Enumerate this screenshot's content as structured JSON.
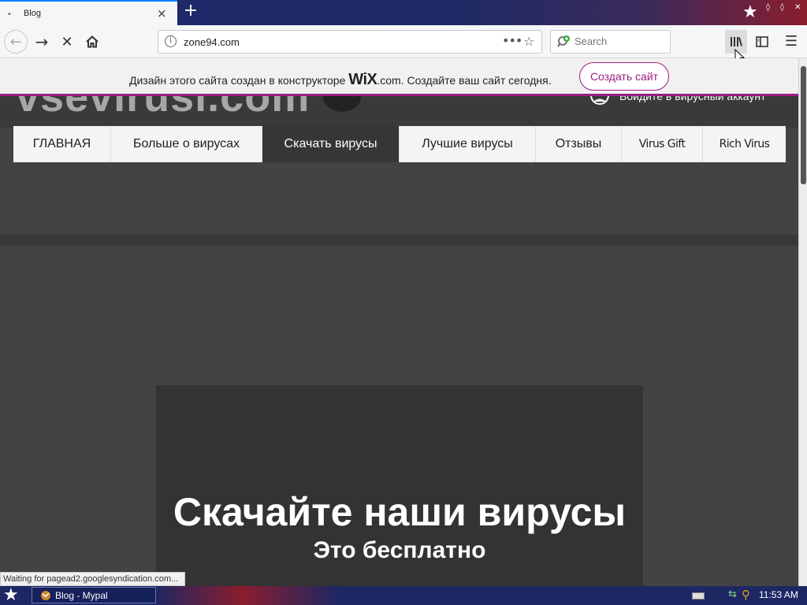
{
  "browser": {
    "tab": {
      "title": "Blog",
      "close_glyph": "×"
    },
    "new_tab_glyph": "+",
    "url": "zone94.com",
    "url_more_glyph": "•••",
    "search_placeholder": "Search",
    "icons": [
      "back-arrow-icon",
      "forward-arrow-icon",
      "stop-icon",
      "home-icon",
      "info-icon",
      "bookmark-star-icon",
      "search-icon",
      "library-icon",
      "sidebar-icon",
      "hamburger-menu-icon"
    ]
  },
  "wix_banner": {
    "text_before": "Дизайн этого сайта создан в конструкторе",
    "brand": "WiX",
    "text_after": ".com. Создайте ваш сайт сегодня.",
    "cta": "Создать сайт"
  },
  "site": {
    "logo": "vsevirusi.com",
    "account_link": "Войдите в вирусный аккаунт",
    "menu": [
      {
        "label": "ГЛАВНАЯ",
        "active": false
      },
      {
        "label": "Больше о вирусах",
        "active": false
      },
      {
        "label": "Скачать вирусы",
        "active": true
      },
      {
        "label": "Лучшие вирусы",
        "active": false
      },
      {
        "label": "Отзывы",
        "active": false
      },
      {
        "label": "Virus Gift",
        "active": false
      },
      {
        "label": "Rich Virus",
        "active": false
      }
    ],
    "hero": {
      "title": "Скачайте наши вирусы",
      "subtitle": "Это бесплатно"
    }
  },
  "status_text": "Waiting for pagead2.googlesyndication.com...",
  "taskbar": {
    "window_label": "Blog - Mypal",
    "clock": "11:53 AM"
  },
  "colors": {
    "wix_accent": "#9c1d84",
    "page_bg": "#434343",
    "menu_active_bg": "#363636",
    "menu_bg": "#f4f4f4",
    "focus_blue": "#0a84ff"
  }
}
